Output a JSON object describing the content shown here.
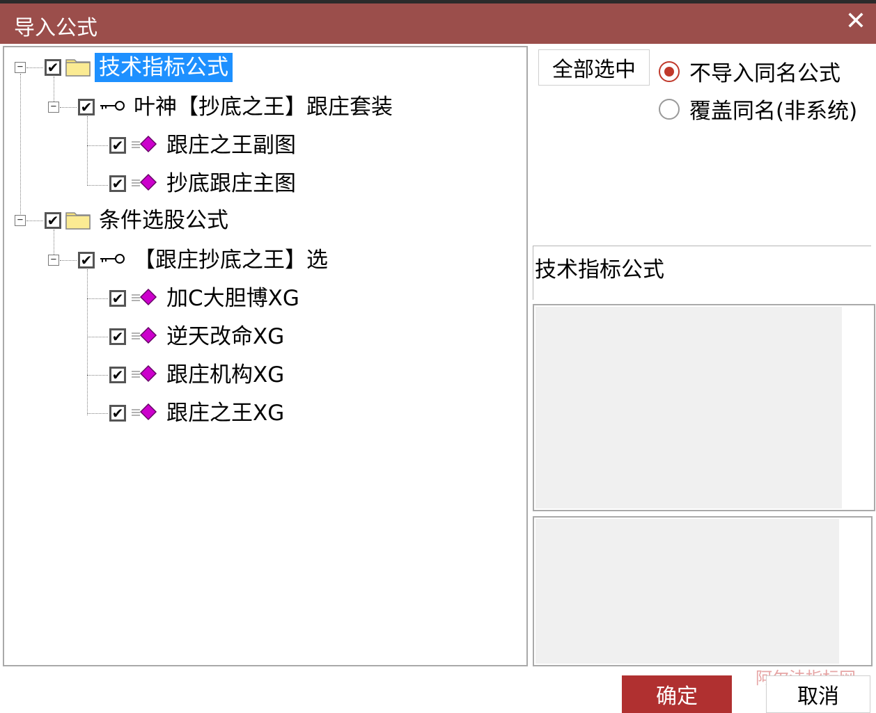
{
  "window": {
    "title": "导入公式",
    "close_glyph": "✕"
  },
  "tree": {
    "items": [
      {
        "label": "技术指标公式",
        "checked": true,
        "icon": "folder-icon",
        "expander": "−",
        "selected": true
      },
      {
        "label": "叶神【抄底之王】跟庄套装",
        "checked": true,
        "icon": "key-icon",
        "expander": "−"
      },
      {
        "label": "跟庄之王副图",
        "checked": true,
        "icon": "formula-icon"
      },
      {
        "label": "抄底跟庄主图",
        "checked": true,
        "icon": "formula-icon"
      },
      {
        "label": "条件选股公式",
        "checked": true,
        "icon": "folder-icon",
        "expander": "−"
      },
      {
        "label": "【跟庄抄底之王】选",
        "checked": true,
        "icon": "key-icon",
        "expander": "−"
      },
      {
        "label": "加C大胆博XG",
        "checked": true,
        "icon": "formula-icon"
      },
      {
        "label": "逆天改命XG",
        "checked": true,
        "icon": "formula-icon"
      },
      {
        "label": "跟庄机构XG",
        "checked": true,
        "icon": "formula-icon"
      },
      {
        "label": "跟庄之王XG",
        "checked": true,
        "icon": "formula-icon"
      }
    ],
    "check_glyph": "✔"
  },
  "options": {
    "select_all_label": "全部选中",
    "radio_skip_label": "不导入同名公式",
    "radio_overwrite_label": "覆盖同名(非系统)",
    "selected_radio": "skip"
  },
  "info": {
    "title": "技术指标公式"
  },
  "footer": {
    "ok_label": "确定",
    "cancel_label": "取消"
  },
  "watermark": {
    "text": "阿尔法指标网"
  },
  "colors": {
    "titlebar": "#9b4e4b",
    "selection": "#1e90ff",
    "ok_button": "#b03030",
    "radio_on": "#c0392b",
    "formula_icon": "#cc00cc",
    "folder_icon": "#f7e37a"
  }
}
